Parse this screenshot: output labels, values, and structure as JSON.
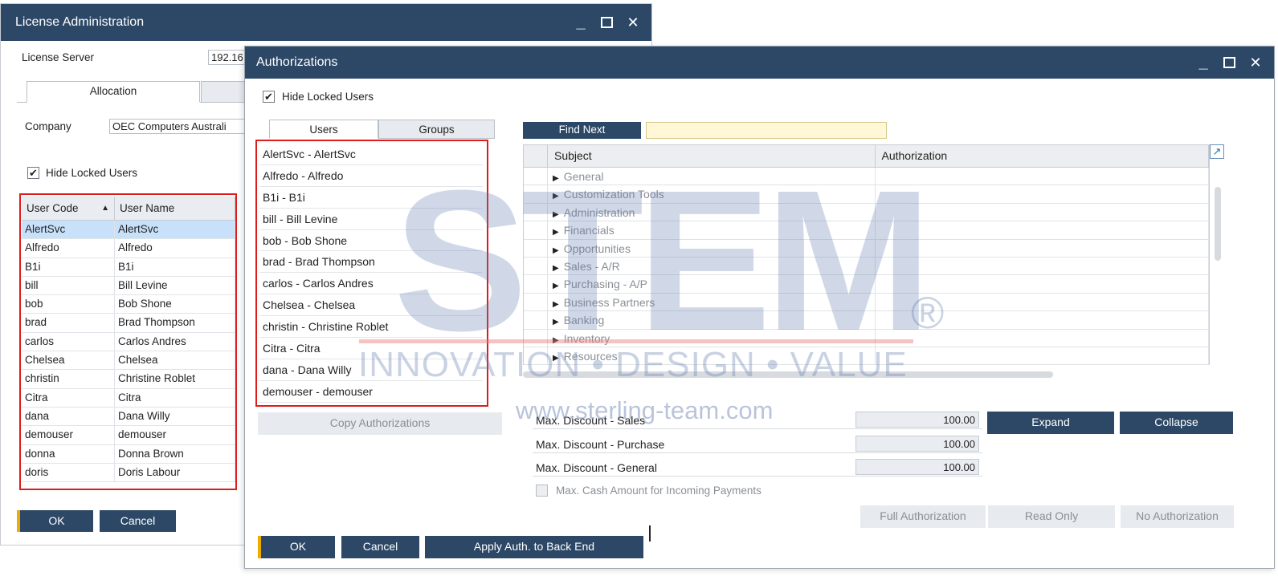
{
  "license_window": {
    "title": "License Administration",
    "license_server_label": "License Server",
    "license_server_value": "192.16",
    "tabs": [
      "Allocation",
      ""
    ],
    "company_label": "Company",
    "company_value": "OEC Computers Australi",
    "hide_locked_label": "Hide Locked Users",
    "hide_locked_checked": true,
    "grid": {
      "columns": [
        "User Code",
        "User Name"
      ],
      "rows": [
        [
          "AlertSvc",
          "AlertSvc"
        ],
        [
          "Alfredo",
          "Alfredo"
        ],
        [
          "B1i",
          "B1i"
        ],
        [
          "bill",
          "Bill Levine"
        ],
        [
          "bob",
          "Bob Shone"
        ],
        [
          "brad",
          "Brad Thompson"
        ],
        [
          "carlos",
          "Carlos Andres"
        ],
        [
          "Chelsea",
          "Chelsea"
        ],
        [
          "christin",
          "Christine Roblet"
        ],
        [
          "Citra",
          "Citra"
        ],
        [
          "dana",
          "Dana Willy"
        ],
        [
          "demouser",
          "demouser"
        ],
        [
          "donna",
          "Donna Brown"
        ],
        [
          "doris",
          "Doris Labour"
        ]
      ]
    },
    "ok_label": "OK",
    "cancel_label": "Cancel"
  },
  "auth_window": {
    "title": "Authorizations",
    "hide_locked_label": "Hide Locked Users",
    "hide_locked_checked": true,
    "tabs": [
      "Users",
      "Groups"
    ],
    "users": [
      "AlertSvc - AlertSvc",
      "Alfredo - Alfredo",
      "B1i - B1i",
      "bill - Bill Levine",
      "bob - Bob Shone",
      "brad - Brad Thompson",
      "carlos - Carlos Andres",
      "Chelsea - Chelsea",
      "christin - Christine Roblet",
      "Citra - Citra",
      "dana - Dana Willy",
      "demouser - demouser"
    ],
    "copy_auth_label": "Copy Authorizations",
    "find_next_label": "Find Next",
    "find_value": "",
    "tree_columns": [
      "Subject",
      "Authorization"
    ],
    "subjects": [
      "General",
      "Customization Tools",
      "Administration",
      "Financials",
      "Opportunities",
      "Sales - A/R",
      "Purchasing - A/P",
      "Business Partners",
      "Banking",
      "Inventory",
      "Resources"
    ],
    "discounts": [
      {
        "label": "Max. Discount - Sales",
        "value": "100.00"
      },
      {
        "label": "Max. Discount - Purchase",
        "value": "100.00"
      },
      {
        "label": "Max. Discount - General",
        "value": "100.00"
      }
    ],
    "cash_amount_label": "Max. Cash Amount for Incoming Payments",
    "expand_label": "Expand",
    "collapse_label": "Collapse",
    "full_auth_label": "Full Authorization",
    "read_only_label": "Read Only",
    "no_auth_label": "No Authorization",
    "ok_label": "OK",
    "cancel_label": "Cancel",
    "apply_label": "Apply Auth. to Back End"
  },
  "watermark": {
    "logo_text": "STEM",
    "registered": "®",
    "tagline": "INNOVATION • DESIGN • VALUE",
    "url": "www.sterling-team.com"
  },
  "icons": {
    "minimize": "minimize-icon",
    "maximize": "maximize-icon",
    "close": "close-icon",
    "sort_up": "sort-ascending-icon",
    "expand_arrow": "expand-arrow-icon",
    "popout": "popout-icon"
  },
  "colors": {
    "titlebar": "#2c4866",
    "button": "#2c4866",
    "accent": "#f0ab00",
    "selection": "#c8e1fb",
    "highlight_box": "#e01b1b",
    "find_field": "#fff7d6"
  }
}
